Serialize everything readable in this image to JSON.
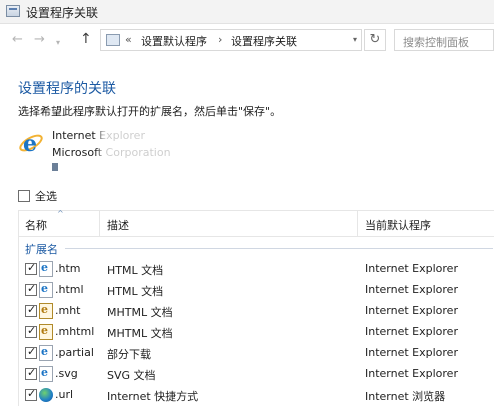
{
  "window": {
    "title": "设置程序关联"
  },
  "nav": {
    "back": "←",
    "forward": "→",
    "recent": "▾",
    "up": "↑",
    "breadcrumb_chevron": "«",
    "breadcrumb": [
      "设置默认程序",
      "设置程序关联"
    ],
    "breadcrumb_sep": "›",
    "address_dropdown": "▾",
    "refresh": "↻",
    "search_placeholder": "搜索控制面板"
  },
  "page": {
    "title": "设置程序的关联",
    "subtitle": "选择希望此程序默认打开的扩展名，然后单击\"保存\"。",
    "program_name": "Internet Explorer",
    "company": "Microsoft Corporation"
  },
  "select_all": {
    "label": "全选",
    "checked": false
  },
  "table": {
    "headers": {
      "name": "名称",
      "desc": "描述",
      "program": "当前默认程序"
    },
    "sort_indicator": "^",
    "group": "扩展名",
    "rows": [
      {
        "ext": ".htm",
        "desc": "HTML 文档",
        "program": "Internet Explorer",
        "icon": "ie-document-icon",
        "checked": true
      },
      {
        "ext": ".html",
        "desc": "HTML 文档",
        "program": "Internet Explorer",
        "icon": "ie-document-icon",
        "checked": true
      },
      {
        "ext": ".mht",
        "desc": "MHTML 文档",
        "program": "Internet Explorer",
        "icon": "mhtml-document-icon",
        "checked": true
      },
      {
        "ext": ".mhtml",
        "desc": "MHTML 文档",
        "program": "Internet Explorer",
        "icon": "mhtml-document-icon",
        "checked": true
      },
      {
        "ext": ".partial",
        "desc": "部分下载",
        "program": "Internet Explorer",
        "icon": "ie-document-icon",
        "checked": true
      },
      {
        "ext": ".svg",
        "desc": "SVG 文档",
        "program": "Internet Explorer",
        "icon": "ie-document-icon",
        "checked": true
      },
      {
        "ext": ".url",
        "desc": "Internet 快捷方式",
        "program": "Internet 浏览器",
        "icon": "globe-icon",
        "checked": true
      }
    ]
  },
  "colors": {
    "heading": "#1c5aa3",
    "accent": "#1b74c5"
  }
}
